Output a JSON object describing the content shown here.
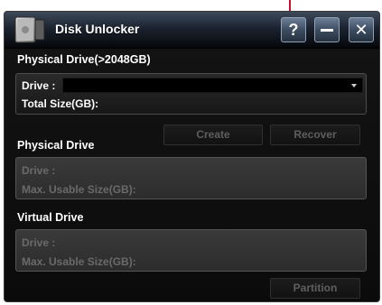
{
  "window": {
    "title": "Disk Unlocker",
    "app_icon": "disk-drive-icon"
  },
  "titlebar_buttons": {
    "help_label": "?",
    "minimize_icon": "minimize-icon",
    "close_label": "✕"
  },
  "large_drive": {
    "heading": "Physical Drive(>2048GB)",
    "drive_label": "Drive :",
    "drive_value": "",
    "total_size_label": "Total Size(GB):"
  },
  "actions": {
    "create_label": "Create",
    "recover_label": "Recover",
    "partition_label": "Partition"
  },
  "physical_drive": {
    "heading": "Physical Drive",
    "drive_label": "Drive :",
    "max_size_label": "Max. Usable Size(GB):"
  },
  "virtual_drive": {
    "heading": "Virtual Drive",
    "drive_label": "Drive :",
    "max_size_label": "Max. Usable Size(GB):"
  },
  "colors": {
    "titlebar": "#1c2330",
    "window_bg": "#0f0f0f",
    "disabled_text": "#6a6a6a",
    "active_text": "#ffffff"
  }
}
